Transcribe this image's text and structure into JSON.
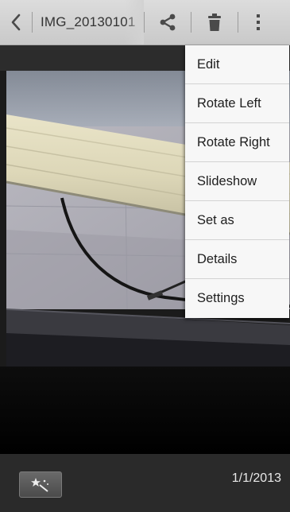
{
  "action_bar": {
    "back_icon": "chevron-left-icon",
    "title": "IMG_20130101",
    "share_icon": "share-icon",
    "delete_icon": "trash-icon",
    "overflow_icon": "overflow-menu-icon",
    "background": "#d2d2d2"
  },
  "menu": {
    "items": [
      {
        "label": "Edit"
      },
      {
        "label": "Rotate Left"
      },
      {
        "label": "Rotate Right"
      },
      {
        "label": "Slideshow"
      },
      {
        "label": "Set as"
      },
      {
        "label": "Details"
      },
      {
        "label": "Settings"
      }
    ]
  },
  "bottom_bar": {
    "magic_icon": "magic-wand-icon",
    "date": "1/1/2013"
  }
}
